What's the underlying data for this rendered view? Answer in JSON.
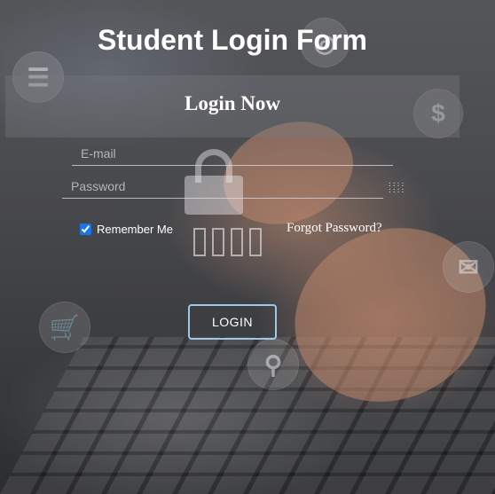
{
  "page": {
    "title": "Student Login Form"
  },
  "form": {
    "heading": "Login Now",
    "email": {
      "value": "",
      "placeholder": "E-mail"
    },
    "password": {
      "value": "",
      "placeholder": "Password"
    },
    "remember_label": "Remember Me",
    "remember_checked": true,
    "forgot_label": "Forgot Password?",
    "login_label": "LOGIN"
  },
  "icons": {
    "background": [
      "lock-icon",
      "dollar-icon",
      "envelope-icon",
      "cart-icon",
      "search-icon",
      "document-icon"
    ],
    "password_toggle": "eye-icon"
  },
  "colors": {
    "accent_border": "#9fc8e8",
    "text": "#ffffff",
    "checkbox": "#1a73e8"
  }
}
